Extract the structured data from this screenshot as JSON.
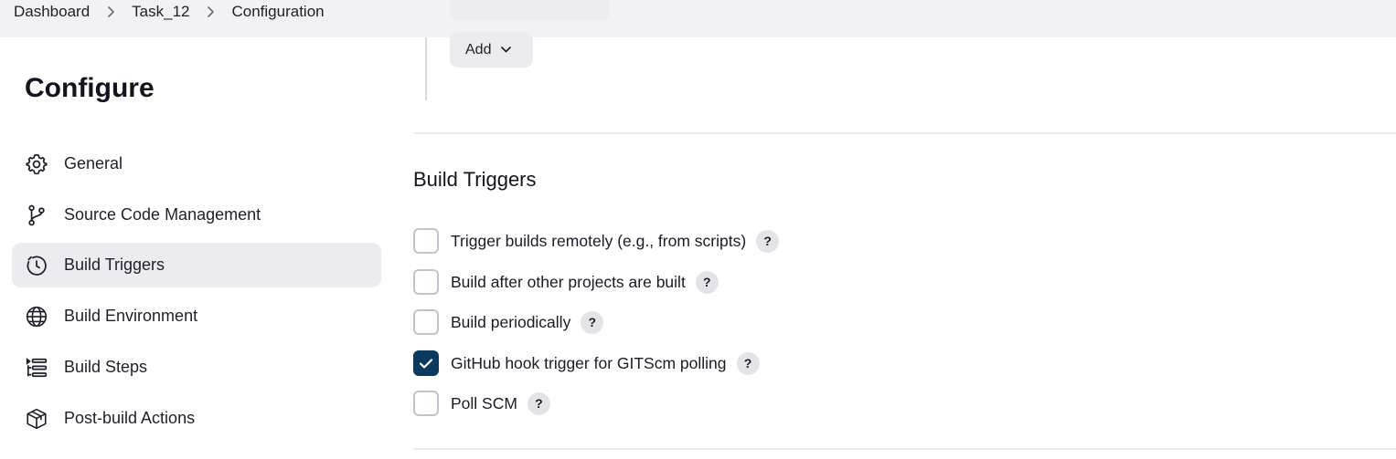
{
  "breadcrumb": {
    "items": [
      "Dashboard",
      "Task_12",
      "Configuration"
    ]
  },
  "add_button": {
    "label": "Add"
  },
  "page_title": "Configure",
  "sidebar": {
    "items": [
      {
        "label": "General",
        "icon": "gear-icon",
        "active": false
      },
      {
        "label": "Source Code Management",
        "icon": "git-branch-icon",
        "active": false
      },
      {
        "label": "Build Triggers",
        "icon": "timer-icon",
        "active": true
      },
      {
        "label": "Build Environment",
        "icon": "globe-icon",
        "active": false
      },
      {
        "label": "Build Steps",
        "icon": "list-icon",
        "active": false
      },
      {
        "label": "Post-build Actions",
        "icon": "package-icon",
        "active": false
      }
    ]
  },
  "build_triggers": {
    "title": "Build Triggers",
    "help_symbol": "?",
    "options": [
      {
        "label": "Trigger builds remotely (e.g., from scripts)",
        "checked": false
      },
      {
        "label": "Build after other projects are built",
        "checked": false
      },
      {
        "label": "Build periodically",
        "checked": false
      },
      {
        "label": "GitHub hook trigger for GITScm polling",
        "checked": true
      },
      {
        "label": "Poll SCM",
        "checked": false
      }
    ]
  },
  "colors": {
    "checkbox_checked": "#0c3a5e",
    "active_nav_bg": "#ececf0",
    "topbar_bg": "#f2f2f4"
  }
}
